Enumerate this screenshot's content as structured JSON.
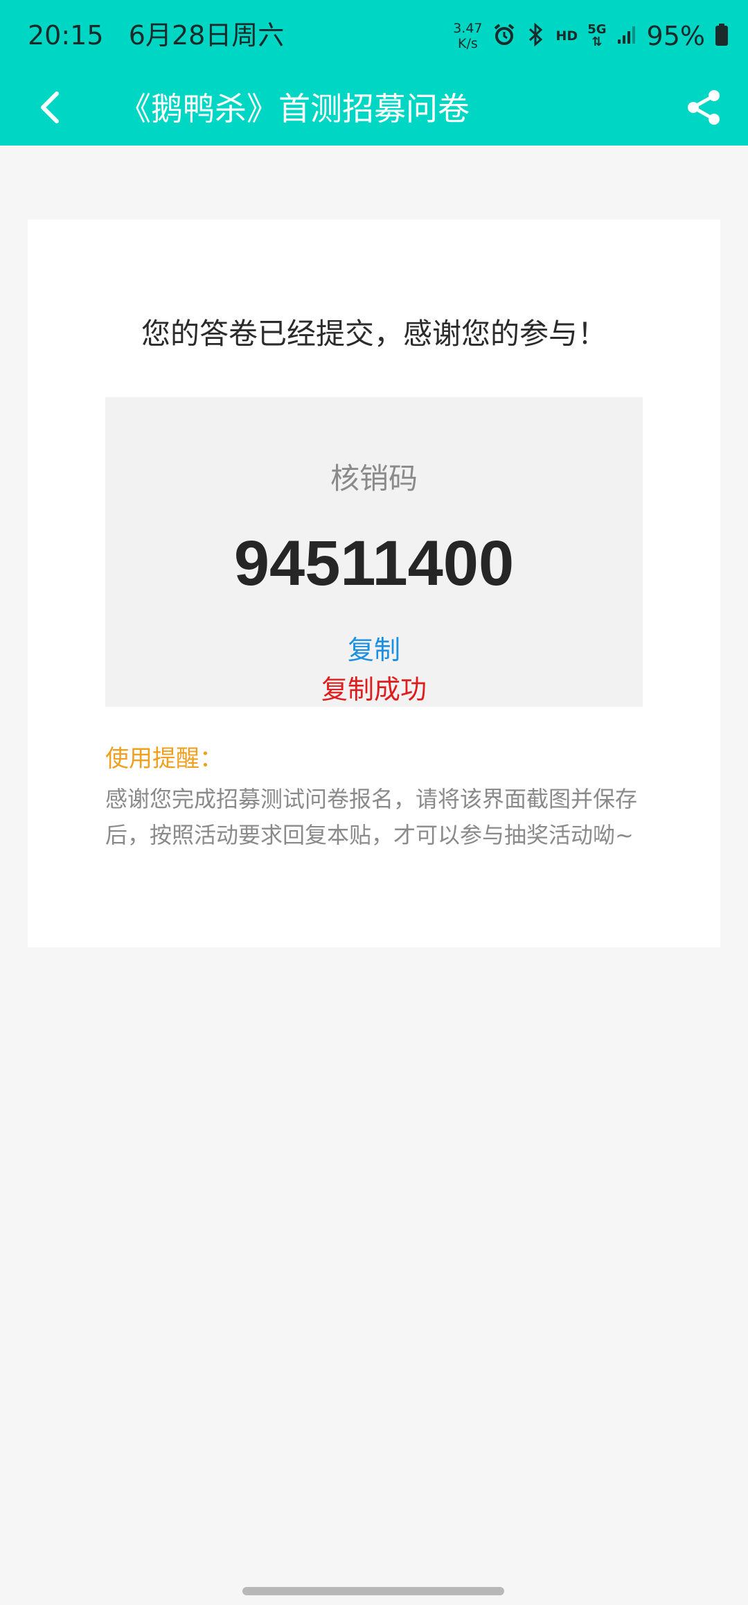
{
  "status": {
    "time": "20:15",
    "date": "6月28日周六",
    "net_speed_value": "3.47",
    "net_speed_unit": "K/s",
    "hd_label": "HD",
    "network_label": "5G",
    "battery_percent": "95%",
    "icons": [
      "alarm-icon",
      "bluetooth-icon",
      "signal-icon",
      "battery-icon"
    ]
  },
  "navbar": {
    "title": "《鹅鸭杀》首测招募问卷",
    "back_icon": "chevron-left-icon",
    "share_icon": "share-icon"
  },
  "content": {
    "thanks_message": "您的答卷已经提交，感谢您的参与！",
    "code_label": "核销码",
    "code_value": "94511400",
    "copy_label": "复制",
    "copy_success": "复制成功",
    "tip_title": "使用提醒：",
    "tip_text": "感谢您完成招募测试问卷报名，请将该界面截图并保存后，按照活动要求回复本贴，才可以参与抽奖活动呦~"
  },
  "colors": {
    "header_bg": "#00d6c4",
    "copy_link": "#1a8fe3",
    "success": "#e01d1d",
    "tip_title": "#f0a020"
  }
}
